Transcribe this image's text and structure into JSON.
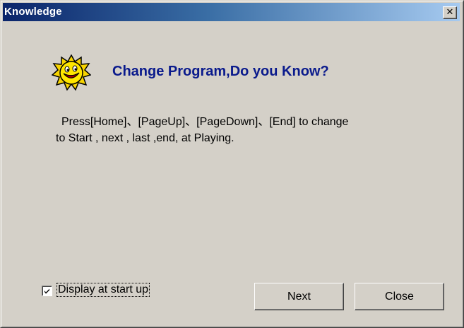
{
  "window": {
    "title": "Knowledge",
    "close_glyph": "✕"
  },
  "tip": {
    "icon": "smiling-sun-icon",
    "heading": "Change Program,Do you Know?",
    "line1": "Press[Home]、[PageUp]、[PageDown]、[End] to change",
    "line2": "to Start , next , last ,end, at Playing."
  },
  "options": {
    "display_at_startup_label": "Display at start up",
    "display_at_startup_checked": true
  },
  "buttons": {
    "next_label": "Next",
    "close_label": "Close"
  }
}
